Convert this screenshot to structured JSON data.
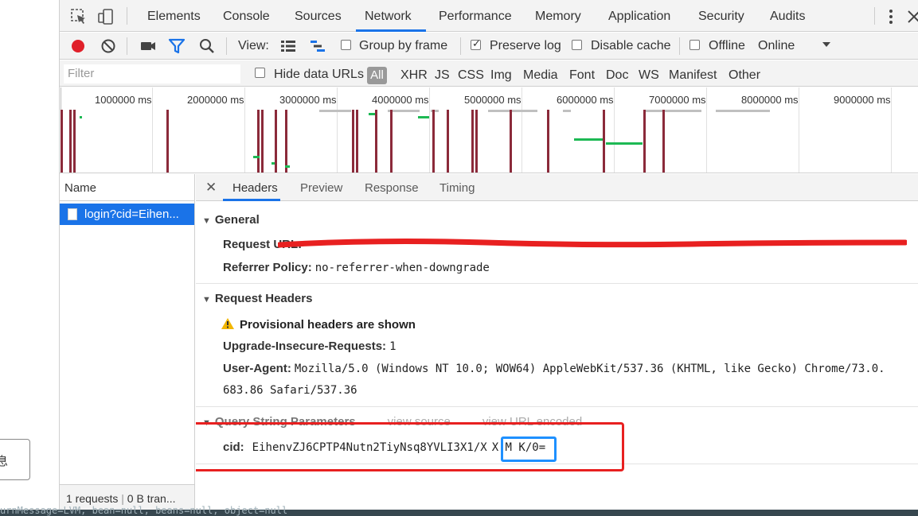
{
  "page": {
    "side_button_text": "息",
    "bottom_console_text": "urnMessage=LVM, bean=null, beans=null, object=null"
  },
  "devtools": {
    "tabs": [
      "Elements",
      "Console",
      "Sources",
      "Network",
      "Performance",
      "Memory",
      "Application",
      "Security",
      "Audits"
    ],
    "active_tab": "Network",
    "icons": {
      "inspect": "select-element-icon",
      "device": "device-toolbar-icon",
      "more": "vertical-ellipsis-icon",
      "close": "close-icon"
    }
  },
  "network_toolbar": {
    "view_label": "View:",
    "group_by_frame": "Group by frame",
    "preserve_log": "Preserve log",
    "preserve_log_checked": true,
    "disable_cache": "Disable cache",
    "offline": "Offline",
    "throttle": "Online"
  },
  "filter_bar": {
    "placeholder": "Filter",
    "hide_data_urls": "Hide data URLs",
    "types": [
      "All",
      "XHR",
      "JS",
      "CSS",
      "Img",
      "Media",
      "Font",
      "Doc",
      "WS",
      "Manifest",
      "Other"
    ]
  },
  "overview": {
    "ticks": [
      "1000000 ms",
      "2000000 ms",
      "3000000 ms",
      "4000000 ms",
      "5000000 ms",
      "6000000 ms",
      "7000000 ms",
      "8000000 ms",
      "9000000 ms"
    ]
  },
  "requests": {
    "column": "Name",
    "items": [
      "login?cid=Eihen..."
    ],
    "footer_count": "1 requests",
    "footer_transfer": "0 B tran..."
  },
  "detail": {
    "tabs": [
      "Headers",
      "Preview",
      "Response",
      "Timing"
    ],
    "active_tab": "Headers",
    "general": {
      "title": "General",
      "request_url_label": "Request URL:",
      "referrer_policy_label": "Referrer Policy:",
      "referrer_policy_value": "no-referrer-when-downgrade"
    },
    "request_headers": {
      "title": "Request Headers",
      "provisional": "Provisional headers are shown",
      "upgrade_label": "Upgrade-Insecure-Requests:",
      "upgrade_value": "1",
      "ua_label": "User-Agent:",
      "ua_value": "Mozilla/5.0 (Windows NT 10.0; WOW64) AppleWebKit/537.36 (KHTML, like Gecko) Chrome/73.0.",
      "ua_value_2": "683.86 Safari/537.36"
    },
    "query": {
      "title": "Query String Parameters",
      "view_source": "view source",
      "view_url_encoded": "view URL encoded",
      "cid_label": "cid:",
      "cid_value_prefix": "EihenvZJ6CPTP4Nutn2TiyNsq8YVLI3X1/X",
      "cid_value_highlight": "X M K/0",
      "cid_value_suffix": "="
    }
  },
  "colors": {
    "accent": "#1a73e8",
    "annotation_red": "#e82020",
    "annotation_blue": "#1e90ff",
    "record": "#e0202a"
  }
}
